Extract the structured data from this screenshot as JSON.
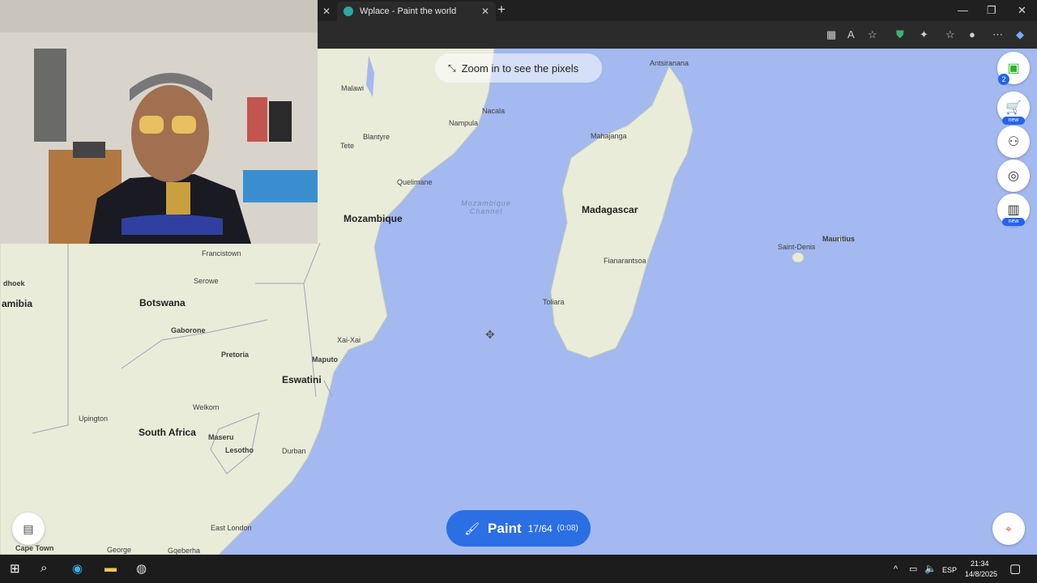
{
  "browser": {
    "active_tab_title": "Wplace - Paint the world",
    "close_glyph": "✕",
    "new_tab_glyph": "+",
    "window_controls": [
      "—",
      "❐",
      "✕"
    ]
  },
  "map": {
    "zoom_hint": "Zoom in to see the pixels",
    "labels": {
      "antsiranana": "Antsiranana",
      "malawi": "Malawi",
      "nacala": "Nacala",
      "nampula": "Nampula",
      "mahajanga": "Mahajanga",
      "tete": "Tete",
      "blantyre": "Blantyre",
      "quelimane": "Quelimane",
      "mozambique_channel": "Mozambique Channel",
      "mozambique": "Mozambique",
      "madagascar": "Madagascar",
      "mauritius": "Mauritius",
      "saint_denis": "Saint-Denis",
      "francistown": "Francistown",
      "fianarantsoa": "Fianarantsoa",
      "windhoek": "dhoek",
      "serowe": "Serowe",
      "namibia": "amibia",
      "botswana": "Botswana",
      "toliara": "Toliara",
      "gaborone": "Gaborone",
      "xai_xai": "Xai-Xai",
      "pretoria": "Pretoria",
      "maputo": "Maputo",
      "eswatini": "Eswatini",
      "welkom": "Welkom",
      "upington": "Upington",
      "south_africa": "South Africa",
      "maseru": "Maseru",
      "lesotho": "Lesotho",
      "durban": "Durban",
      "east_london": "East London",
      "cape_town": "Cape Town",
      "george": "George",
      "gqeberha": "Gqeberha"
    }
  },
  "side_panel": {
    "avatar_count": "2",
    "new_badge": "new"
  },
  "paint": {
    "label": "Paint",
    "count": "17/64",
    "timer": "(0:08)"
  },
  "taskbar": {
    "language": "ESP",
    "time": "21:34",
    "date": "14/8/2025"
  },
  "colors": {
    "sea": "#a3b9ef",
    "land": "#e9ecd9",
    "paint_button": "#2b6fe3",
    "badge": "#2563eb"
  }
}
